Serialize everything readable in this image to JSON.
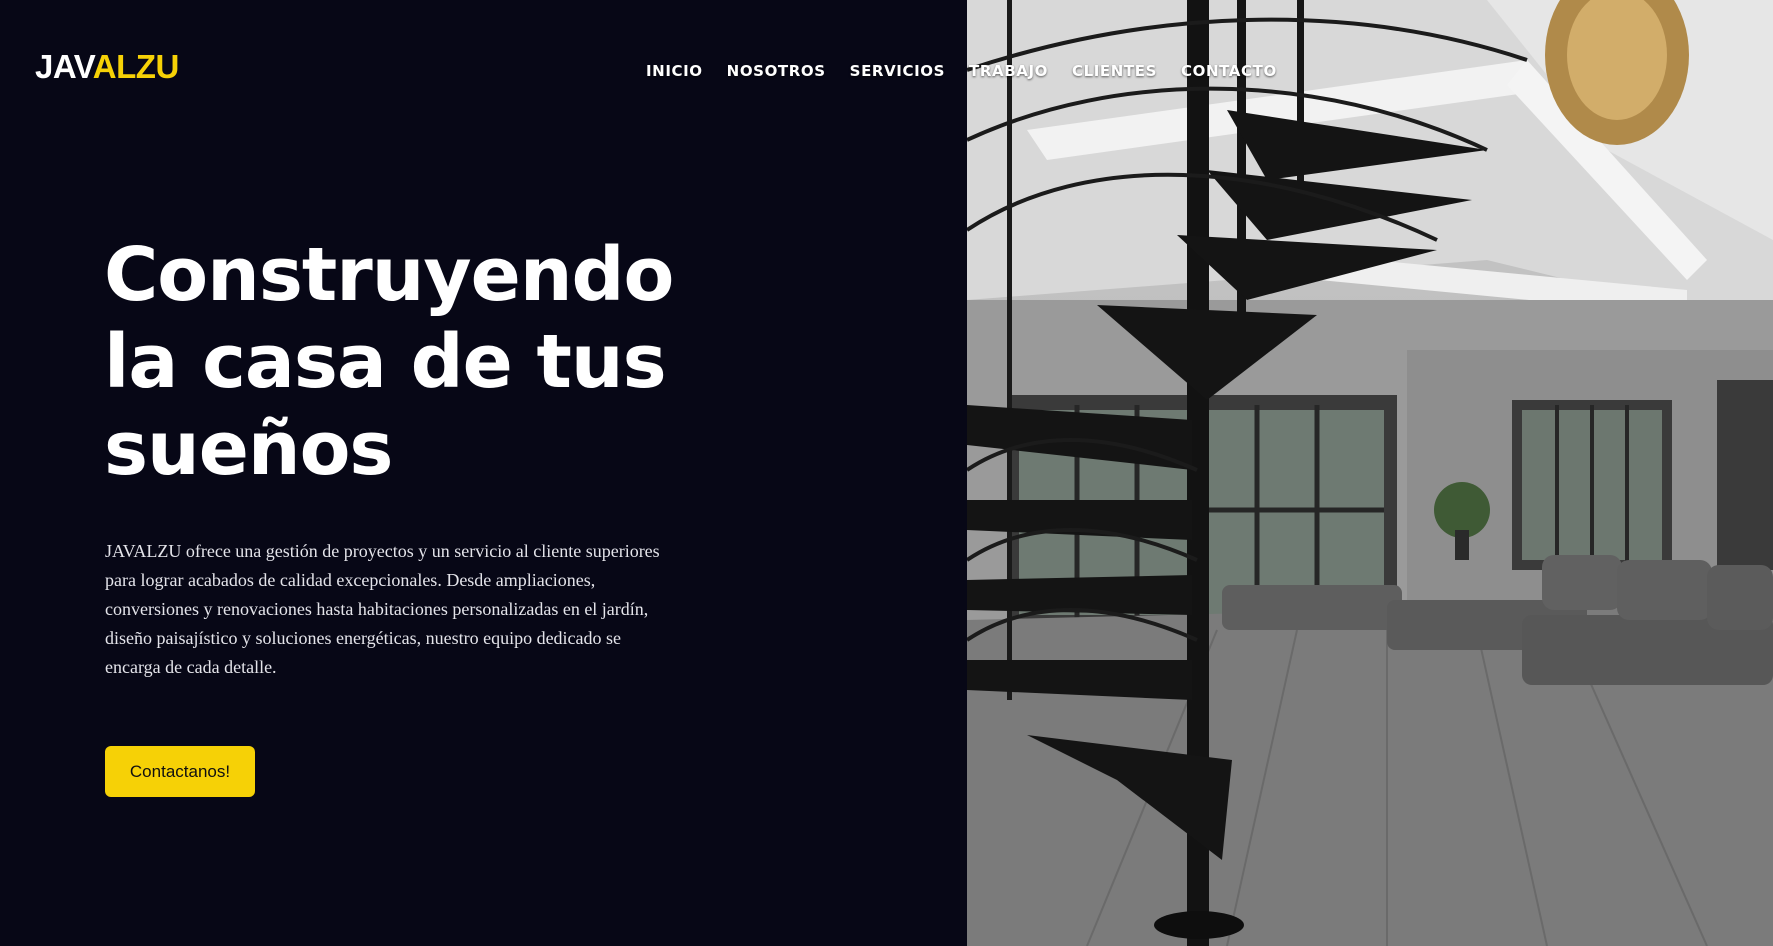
{
  "brand": {
    "logo_part_a": "JAV",
    "logo_part_b": "ALZU"
  },
  "nav": {
    "items": [
      {
        "label": "INICIO"
      },
      {
        "label": "NOSOTROS"
      },
      {
        "label": "SERVICIOS"
      },
      {
        "label": "TRABAJO"
      },
      {
        "label": "CLIENTES"
      },
      {
        "label": "CONTACTO"
      }
    ]
  },
  "hero": {
    "headline_line1": "Construyendo",
    "headline_line2": "la casa de tus",
    "headline_line3": "sueños",
    "description": "JAVALZU ofrece una gestión de proyectos y un servicio al cliente superiores para lograr acabados de calidad excepcionales. Desde ampliaciones, conversiones y renovaciones hasta habitaciones personalizadas en el jardín, diseño paisajístico y soluciones energéticas, nuestro equipo dedicado se encarga de cada detalle.",
    "cta_label": "Contactanos!"
  },
  "colors": {
    "background": "#070716",
    "accent": "#f6d106",
    "text": "#ffffff"
  }
}
